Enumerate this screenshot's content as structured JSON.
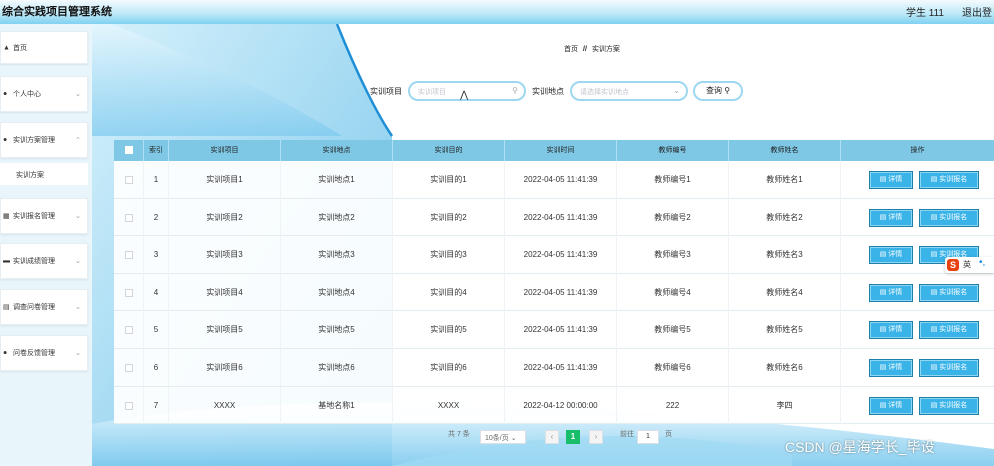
{
  "header": {
    "title": "综合实践项目管理系统",
    "user": "学生 111",
    "logout": "退出登"
  },
  "sidebar": {
    "items": [
      {
        "icon": "home-icon",
        "label": "首页",
        "has_chevron": false
      },
      {
        "icon": "person-icon",
        "label": "个人中心",
        "has_chevron": true
      },
      {
        "icon": "person-icon",
        "label": "实训方案管理",
        "has_chevron": true
      },
      {
        "icon": "grid-icon",
        "label": "实训报名管理",
        "has_chevron": true
      },
      {
        "icon": "monitor-icon",
        "label": "实训成绩管理",
        "has_chevron": true
      },
      {
        "icon": "document-icon",
        "label": "调查问卷管理",
        "has_chevron": true
      },
      {
        "icon": "person-icon",
        "label": "问卷反馈管理",
        "has_chevron": true
      }
    ],
    "submenu": {
      "label": "实训方案"
    }
  },
  "breadcrumb": {
    "home": "首页",
    "separator": "//",
    "current": "实训方案"
  },
  "search": {
    "project_label": "实训项目",
    "project_placeholder": "实训项目",
    "location_label": "实训地点",
    "location_placeholder": "请选择实训地点",
    "button_label": "查询"
  },
  "table": {
    "columns": [
      "索引",
      "实训项目",
      "实训地点",
      "实训目的",
      "实训时间",
      "教师编号",
      "教师姓名",
      "操作"
    ],
    "rows": [
      {
        "index": "1",
        "project": "实训项目1",
        "location": "实训地点1",
        "purpose": "实训目的1",
        "time": "2022-04-05 11:41:39",
        "teacher_no": "教师编号1",
        "teacher_name": "教师姓名1"
      },
      {
        "index": "2",
        "project": "实训项目2",
        "location": "实训地点2",
        "purpose": "实训目的2",
        "time": "2022-04-05 11:41:39",
        "teacher_no": "教师编号2",
        "teacher_name": "教师姓名2"
      },
      {
        "index": "3",
        "project": "实训项目3",
        "location": "实训地点3",
        "purpose": "实训目的3",
        "time": "2022-04-05 11:41:39",
        "teacher_no": "教师编号3",
        "teacher_name": "教师姓名3"
      },
      {
        "index": "4",
        "project": "实训项目4",
        "location": "实训地点4",
        "purpose": "实训目的4",
        "time": "2022-04-05 11:41:39",
        "teacher_no": "教师编号4",
        "teacher_name": "教师姓名4"
      },
      {
        "index": "5",
        "project": "实训项目5",
        "location": "实训地点5",
        "purpose": "实训目的5",
        "time": "2022-04-05 11:41:39",
        "teacher_no": "教师编号5",
        "teacher_name": "教师姓名5"
      },
      {
        "index": "6",
        "project": "实训项目6",
        "location": "实训地点6",
        "purpose": "实训目的6",
        "time": "2022-04-05 11:41:39",
        "teacher_no": "教师编号6",
        "teacher_name": "教师姓名6"
      },
      {
        "index": "7",
        "project": "XXXX",
        "location": "基地名称1",
        "purpose": "XXXX",
        "time": "2022-04-12 00:00:00",
        "teacher_no": "222",
        "teacher_name": "李四"
      }
    ],
    "actions": {
      "detail": "详情",
      "enroll": "实训报名"
    }
  },
  "pagination": {
    "total": "共 7 条",
    "page_size": "10条/页",
    "prev": "‹",
    "current": "1",
    "next": "›",
    "goto_prefix": "前往",
    "goto_value": "1",
    "goto_suffix": "页"
  },
  "ime": {
    "label": "英"
  },
  "watermark": "CSDN @星海学长_毕设",
  "colors": {
    "header_accent": "#7fd1f1",
    "table_header": "#7ec8e6",
    "button": "#39b3e8",
    "page_active": "#19be6b"
  }
}
